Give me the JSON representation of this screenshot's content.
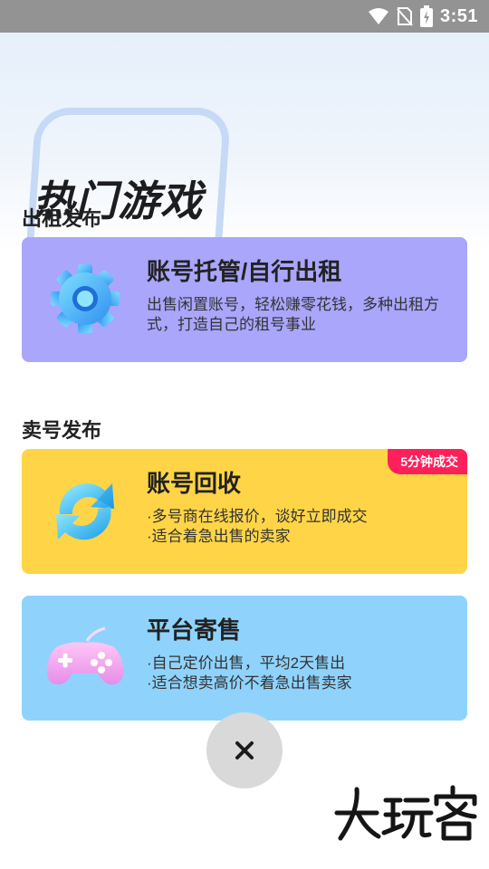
{
  "status_bar": {
    "time": "3:51",
    "icons": [
      "wifi-icon",
      "no-sim-icon",
      "battery-charging-icon"
    ]
  },
  "hero": {
    "title": "热门游戏"
  },
  "sections": {
    "rent_label": "出租发布",
    "sell_label": "卖号发布"
  },
  "cards": {
    "rent": {
      "title": "账号托管/自行出租",
      "desc": "出售闲置账号，轻松赚零花钱，多种出租方式，打造自己的租号事业",
      "color": "#a9a6fc",
      "icon": "gear-icon"
    },
    "recycle": {
      "title": "账号回收",
      "lines": [
        "·多号商在线报价，谈好立即成交",
        "·适合着急出售的卖家"
      ],
      "badge": "5分钟成交",
      "color": "#ffd547",
      "icon": "refresh-icon"
    },
    "consign": {
      "title": "平台寄售",
      "lines": [
        "·自己定价出售，平均2天售出",
        "·适合想卖高价不着急出售卖家"
      ],
      "color": "#8fd3fd",
      "icon": "gamepad-icon"
    }
  },
  "close_label": "×",
  "watermark": "大玩客"
}
